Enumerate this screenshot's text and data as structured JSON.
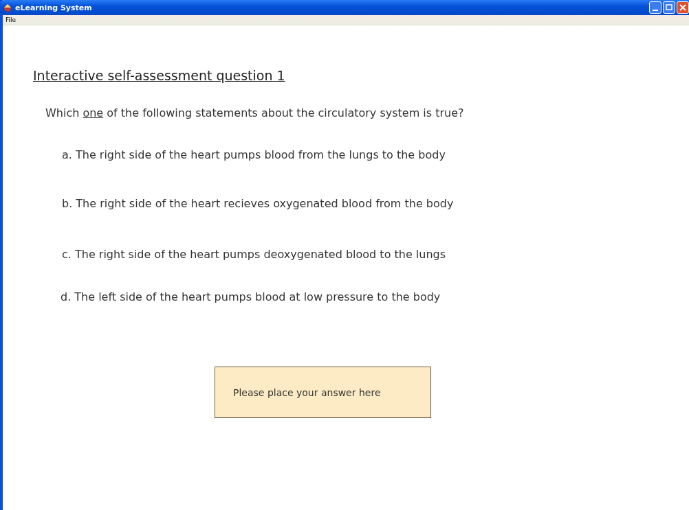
{
  "window": {
    "title": "eLearning System"
  },
  "menu": [
    "File"
  ],
  "heading": "Interactive self-assessment question 1",
  "question": {
    "before": "Which ",
    "underlined": "one",
    "after": "  of the following statements about the circulatory system is true?"
  },
  "options": [
    {
      "text": "a. The right side of the heart pumps blood from the lungs to the body"
    },
    {
      "text": "b. The right side of the heart recieves oxygenated blood from the body"
    },
    {
      "text": "c. The right side of the heart pumps deoxygenated blood to the lungs"
    },
    {
      "text": "d. The left side of the heart pumps blood at low pressure to the body"
    }
  ],
  "answer_box": {
    "placeholder": "Please place your answer here"
  }
}
